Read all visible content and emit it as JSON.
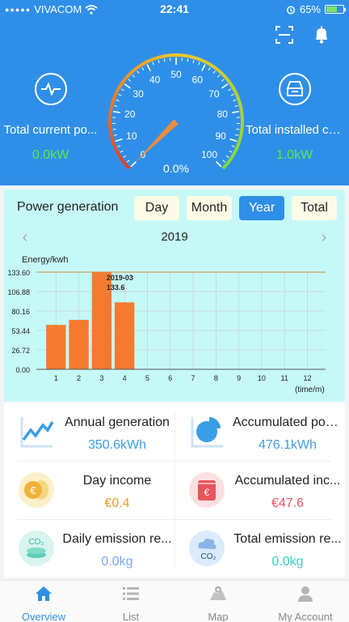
{
  "status_bar": {
    "carrier": "VIVACOM",
    "time": "22:41",
    "battery": "65%",
    "battery_level": 0.65
  },
  "header": {
    "left_stat": {
      "label": "Total current po...",
      "value": "0.0kW",
      "icon": "pulse-icon"
    },
    "right_stat": {
      "label": "Total installed ca...",
      "value": "1.0kW",
      "icon": "panel-icon"
    },
    "gauge": {
      "ticks": [
        "0",
        "10",
        "20",
        "30",
        "40",
        "50",
        "60",
        "70",
        "80",
        "90",
        "100"
      ],
      "percent": "0.0%",
      "value": 0
    }
  },
  "generation": {
    "title": "Power generation",
    "periods": [
      "Day",
      "Month",
      "Year",
      "Total"
    ],
    "active_period": "Year",
    "year": "2019",
    "prev_icon": "chevron-left-icon",
    "next_icon": "chevron-right-icon"
  },
  "chart_data": {
    "type": "bar",
    "ylabel": "Energy/kwh",
    "xlabel": "(time/m)",
    "categories": [
      "1",
      "2",
      "3",
      "4",
      "5",
      "6",
      "7",
      "8",
      "9",
      "10",
      "11",
      "12"
    ],
    "values": [
      61,
      68,
      133.6,
      92,
      0,
      0,
      0,
      0,
      0,
      0,
      0,
      0
    ],
    "yticks": [
      "133.60",
      "106.88",
      "80.16",
      "53.44",
      "26.72",
      "0.00"
    ],
    "ylim": [
      0,
      133.6
    ],
    "annotation": {
      "label": "2019-03",
      "value": "133.6"
    },
    "bar_color": "#f47a2f",
    "grid": true
  },
  "stats": [
    {
      "label": "Annual generation",
      "value": "350.6kWh",
      "color": "#3a9ee6",
      "icon": "trend-chart-icon"
    },
    {
      "label": "Accumulated pow...",
      "value": "476.1kWh",
      "color": "#3a9ee6",
      "icon": "pie-chart-icon"
    },
    {
      "label": "Day income",
      "value": "€0.4",
      "color": "#ef9b2b",
      "icon": "euro-coins-icon"
    },
    {
      "label": "Accumulated inc...",
      "value": "€47.6",
      "color": "#e9545b",
      "icon": "euro-wallet-icon"
    },
    {
      "label": "Daily emission re...",
      "value": "0.0kg",
      "color": "#7ba5f0",
      "icon": "co2-coins-icon"
    },
    {
      "label": "Total emission re...",
      "value": "0.0kg",
      "color": "#35cfc0",
      "icon": "co2-cloud-icon"
    }
  ],
  "tabs": [
    {
      "label": "Overview",
      "icon": "home-icon",
      "active": true
    },
    {
      "label": "List",
      "icon": "list-icon",
      "active": false
    },
    {
      "label": "Map",
      "icon": "map-icon",
      "active": false
    },
    {
      "label": "My Account",
      "icon": "user-icon",
      "active": false
    }
  ],
  "colors": {
    "brand": "#2f8fe8",
    "good": "#59ea4e"
  }
}
